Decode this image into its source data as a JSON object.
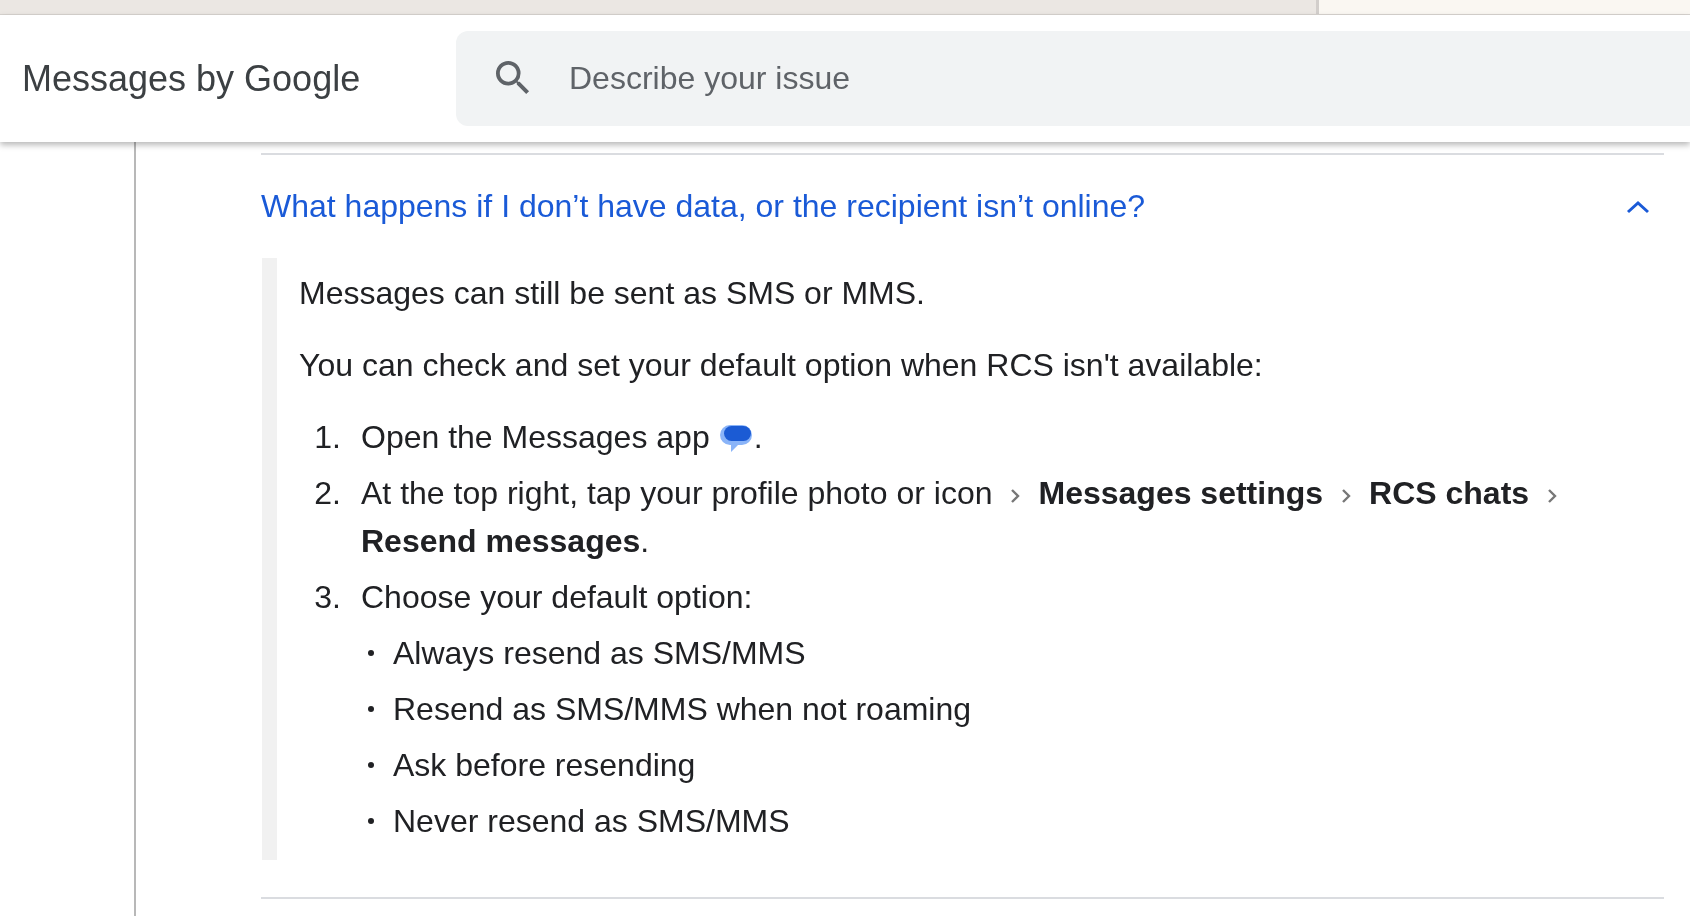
{
  "header": {
    "title": "Messages by Google",
    "search": {
      "placeholder": "Describe your issue"
    }
  },
  "faq": {
    "question": "What happens if I don’t have data, or the recipient isn’t online?",
    "expanded": true,
    "answer": {
      "paragraphs": [
        "Messages can still be sent as SMS or MMS.",
        "You can check and set your default option when RCS isn't available:"
      ],
      "steps": [
        {
          "number": "1.",
          "kind": "app",
          "text": "Open the Messages app",
          "end": "."
        },
        {
          "number": "2.",
          "kind": "path",
          "text": "At the top right, tap your profile photo or icon",
          "path": [
            "Messages settings",
            "RCS chats",
            "Resend messages"
          ],
          "end": "."
        },
        {
          "number": "3.",
          "kind": "options",
          "text": "Choose your default option:",
          "options": [
            "Always resend as SMS/MMS",
            "Resend as SMS/MMS when not roaming",
            "Ask before resending",
            "Never resend as SMS/MMS"
          ]
        }
      ]
    }
  }
}
